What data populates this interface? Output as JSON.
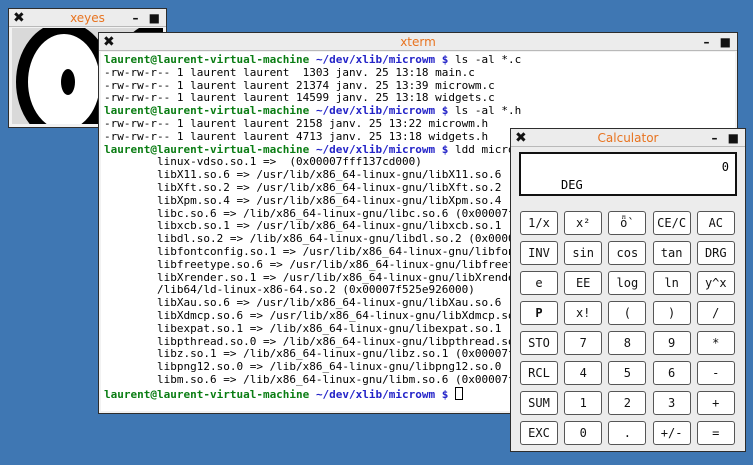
{
  "xeyes": {
    "title": "xeyes",
    "close_glyph": "✖",
    "controls": "– ■"
  },
  "xterm": {
    "title": "xterm",
    "close_glyph": "✖",
    "controls": "– ■",
    "prompt_user": "laurent@laurent-virtual-machine",
    "prompt_path": "~/dev/xlib/microwm",
    "prompt_symbol": "$",
    "lines": [
      {
        "cmd": "ls -al *.c"
      },
      {
        "text": "-rw-rw-r-- 1 laurent laurent  1303 janv. 25 13:18 main.c"
      },
      {
        "text": "-rw-rw-r-- 1 laurent laurent 21374 janv. 25 13:39 microwm.c"
      },
      {
        "text": "-rw-rw-r-- 1 laurent laurent 14599 janv. 25 13:18 widgets.c"
      },
      {
        "cmd": "ls -al *.h"
      },
      {
        "text": "-rw-rw-r-- 1 laurent laurent 2158 janv. 25 13:22 microwm.h"
      },
      {
        "text": "-rw-rw-r-- 1 laurent laurent 4713 janv. 25 13:18 widgets.h"
      },
      {
        "cmd": "ldd microwm"
      },
      {
        "text": "        linux-vdso.so.1 =>  (0x00007fff137cd000)"
      },
      {
        "text": "        libX11.so.6 => /usr/lib/x86_64-linux-gnu/libX11.so.6 (0x0000"
      },
      {
        "text": "        libXft.so.2 => /usr/lib/x86_64-linux-gnu/libXft.so.2 (0x0000"
      },
      {
        "text": "        libXpm.so.4 => /usr/lib/x86_64-linux-gnu/libXpm.so.4 (0x0000"
      },
      {
        "text": "        libc.so.6 => /lib/x86_64-linux-gnu/libc.so.6 (0x00007f525ddc"
      },
      {
        "text": "        libxcb.so.1 => /usr/lib/x86_64-linux-gnu/libxcb.so.1 (0x0000"
      },
      {
        "text": "        libdl.so.2 => /lib/x86_64-linux-gnu/libdl.so.2 (0x00007f525c"
      },
      {
        "text": "        libfontconfig.so.1 => /usr/lib/x86_64-linux-gnu/libfontconfi"
      },
      {
        "text": "        libfreetype.so.6 => /usr/lib/x86_64-linux-gnu/libfreetype.so"
      },
      {
        "text": "        libXrender.so.1 => /usr/lib/x86_64-linux-gnu/libXrender.so.1"
      },
      {
        "text": "        /lib64/ld-linux-x86-64.so.2 (0x00007f525e926000)"
      },
      {
        "text": "        libXau.so.6 => /usr/lib/x86_64-linux-gnu/libXau.so.6 (0x0000"
      },
      {
        "text": "        libXdmcp.so.6 => /usr/lib/x86_64-linux-gnu/libXdmcp.so.6 (0x"
      },
      {
        "text": "        libexpat.so.1 => /lib/x86_64-linux-gnu/libexpat.so.1 (0x0000"
      },
      {
        "text": "        libpthread.so.0 => /lib/x86_64-linux-gnu/libpthread.so.0 (0x"
      },
      {
        "text": "        libz.so.1 => /lib/x86_64-linux-gnu/libz.so.1 (0x00007f525c8E"
      },
      {
        "text": "        libpng12.so.0 => /lib/x86_64-linux-gnu/libpng12.so.0 (0x0000"
      },
      {
        "text": "        libm.so.6 => /lib/x86_64-linux-gnu/libm.so.6 (0x00007f525c33"
      },
      {
        "cmd": "",
        "cursor": true
      }
    ]
  },
  "calculator": {
    "title": "Calculator",
    "close_glyph": "✖",
    "controls": "– ■",
    "display_value": "0",
    "display_mode": "DEG",
    "keys": [
      [
        "1/x",
        "x²",
        "ȫ`",
        "CE/C",
        "AC"
      ],
      [
        "INV",
        "sin",
        "cos",
        "tan",
        "DRG"
      ],
      [
        "e",
        "EE",
        "log",
        "ln",
        "y^x"
      ],
      [
        "P",
        "x!",
        "(",
        ")",
        "/"
      ],
      [
        "STO",
        "7",
        "8",
        "9",
        "*"
      ],
      [
        "RCL",
        "4",
        "5",
        "6",
        "-"
      ],
      [
        "SUM",
        "1",
        "2",
        "3",
        "+"
      ],
      [
        "EXC",
        "0",
        ".",
        "+/-",
        "="
      ]
    ]
  }
}
